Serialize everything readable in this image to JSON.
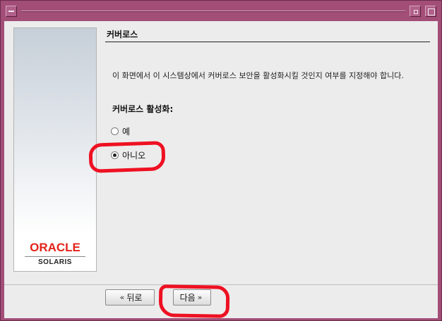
{
  "window": {
    "accent_color": "#a24e77"
  },
  "sidebar": {
    "logo_brand": "ORACLE",
    "logo_product": "SOLARIS"
  },
  "main": {
    "title": "커버로스",
    "description": "이 화면에서 이 시스템상에서 커버로스 보안을 활성화시킬 것인지 여부를 지정해야 합니다.",
    "field_label": "커버로스 활성화:",
    "options": [
      {
        "label": "예",
        "selected": false
      },
      {
        "label": "아니오",
        "selected": true
      }
    ]
  },
  "footer": {
    "back_label": "뒤로",
    "next_label": "다음"
  },
  "annotations": {
    "highlight_color": "#ee1122"
  }
}
